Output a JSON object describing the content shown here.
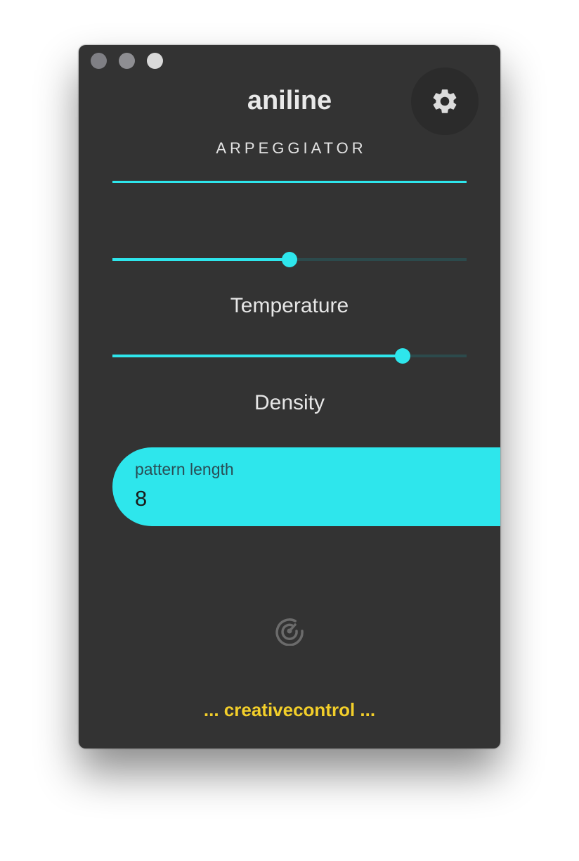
{
  "app": {
    "title": "aniline",
    "mode": "ARPEGGIATOR"
  },
  "window_controls": {
    "icons": [
      "close-dot",
      "minimize-dot",
      "maximize-dot"
    ]
  },
  "settings": {
    "icon": "gear-icon"
  },
  "sliders": [
    {
      "label": "Temperature",
      "value": 0.5
    },
    {
      "label": "Density",
      "value": 0.82
    }
  ],
  "pattern_length": {
    "label": "pattern length",
    "value": "8"
  },
  "radar": {
    "icon": "radar-icon"
  },
  "footer": {
    "text": "... creativecontrol ..."
  },
  "colors": {
    "accent": "#2ee6ec",
    "background": "#333333",
    "footer_text": "#f3cf2a"
  }
}
